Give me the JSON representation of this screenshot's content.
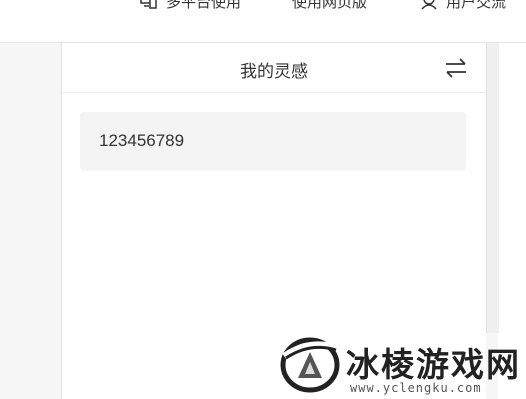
{
  "topnav": {
    "multi_platform": "多平台使用",
    "web_version": "使用网页版",
    "user_exchange": "用户交流"
  },
  "panel": {
    "title": "我的灵感",
    "switch_icon": "swap-arrows-icon"
  },
  "notes": [
    {
      "text": "123456789"
    }
  ],
  "watermark": {
    "title": "冰棱游戏网",
    "url": "www.yclengku.com"
  },
  "colors": {
    "card_bg": "#f4f4f4",
    "page_bg": "#f7f7f7",
    "text": "#333333"
  }
}
